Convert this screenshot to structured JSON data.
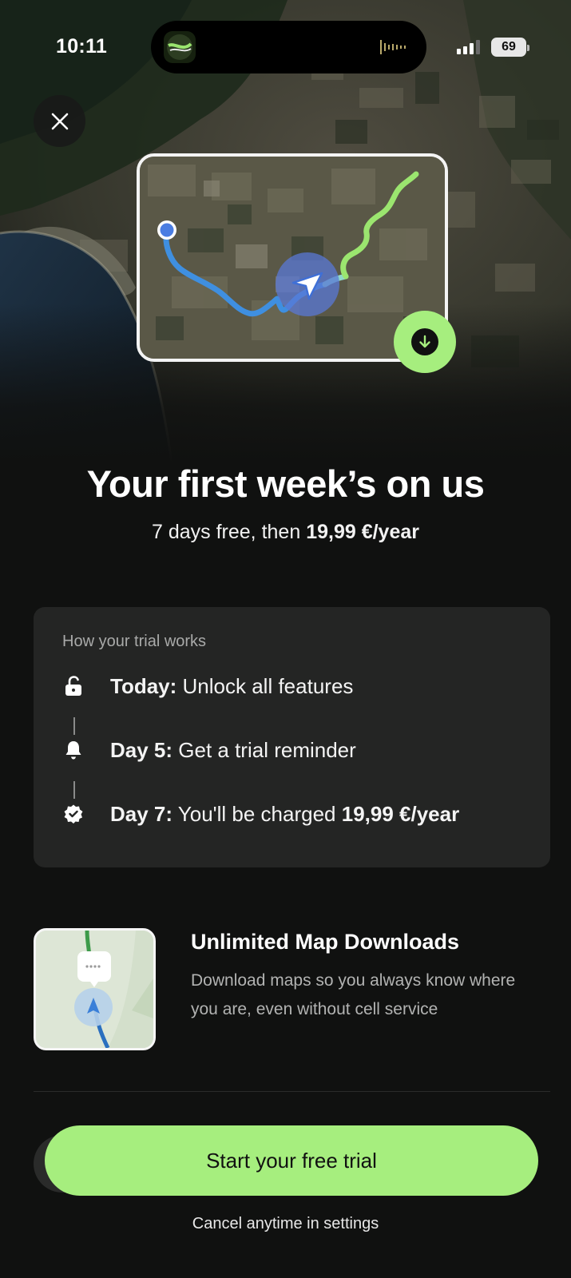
{
  "status_bar": {
    "time": "10:11",
    "battery": "69"
  },
  "icons": {
    "close": "close-icon",
    "download": "arrow-down-icon",
    "unlock": "unlock-icon",
    "bell": "bell-icon",
    "badge_check": "badge-check-icon",
    "navigation_arrow": "navigation-arrow-icon"
  },
  "colors": {
    "accent": "#a6ee7e",
    "route_blue": "#3f8fe0",
    "route_green": "#9be56f",
    "background": "#101110",
    "card": "#242524"
  },
  "hero": {
    "headline": "Your first week’s on us",
    "subline_prefix": "7 days free, then ",
    "subline_price": "19,99 €/year"
  },
  "trial": {
    "title": "How your trial works",
    "steps": [
      {
        "day": "Today:",
        "text": " Unlock all features"
      },
      {
        "day": "Day 5:",
        "text": " Get a trial reminder"
      },
      {
        "day": "Day 7:",
        "text": " You'll be charged ",
        "price": "19,99 €/year"
      }
    ]
  },
  "feature": {
    "title": "Unlimited Map Downloads",
    "description": "Download maps so you always know where you are, even without cell service"
  },
  "cta": {
    "label": "Start your free trial",
    "note": "Cancel anytime in settings"
  }
}
